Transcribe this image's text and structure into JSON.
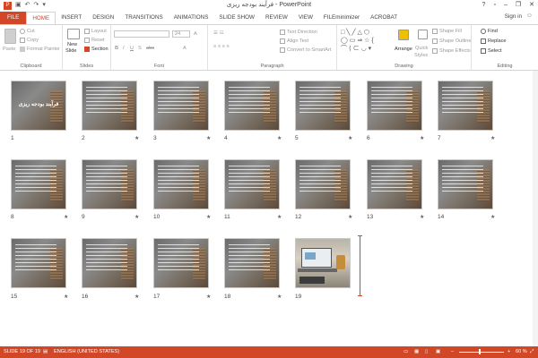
{
  "window": {
    "title": "فرآیند بودجه ریزی - PowerPoint",
    "minimize": "–",
    "restore": "❐",
    "close": "✕",
    "help": "?",
    "ribbon_display": "▫"
  },
  "tabs": [
    "FILE",
    "HOME",
    "INSERT",
    "DESIGN",
    "TRANSITIONS",
    "ANIMATIONS",
    "SLIDE SHOW",
    "REVIEW",
    "VIEW",
    "FILEminimizer",
    "ACROBAT"
  ],
  "active_tab": "HOME",
  "sign_in": "Sign in",
  "ribbon": {
    "clipboard": {
      "label": "Clipboard",
      "paste": "Paste",
      "cut": "Cut",
      "copy": "Copy",
      "format_painter": "Format Painter"
    },
    "slides": {
      "label": "Slides",
      "new_slide": "New",
      "new_slide2": "Slide",
      "layout": "Layout",
      "reset": "Reset",
      "section": "Section"
    },
    "font": {
      "label": "Font",
      "size": "24"
    },
    "paragraph": {
      "label": "Paragraph",
      "text_direction": "Text Direction",
      "align_text": "Align Text",
      "convert_smartart": "Convert to SmartArt"
    },
    "drawing": {
      "label": "Drawing",
      "arrange": "Arrange",
      "quick_styles": "Quick",
      "quick_styles2": "Styles",
      "shape_fill": "Shape Fill",
      "shape_outline": "Shape Outline",
      "shape_effects": "Shape Effects"
    },
    "editing": {
      "label": "Editing",
      "find": "Find",
      "replace": "Replace",
      "select": "Select"
    }
  },
  "slides": [
    {
      "num": "1",
      "title": "فرآیند بودجه ریزی",
      "star": ""
    },
    {
      "num": "2",
      "star": "★"
    },
    {
      "num": "3",
      "star": "★"
    },
    {
      "num": "4",
      "star": "★"
    },
    {
      "num": "5",
      "star": "★"
    },
    {
      "num": "6",
      "star": "★"
    },
    {
      "num": "7",
      "star": "★"
    },
    {
      "num": "8",
      "star": "★"
    },
    {
      "num": "9",
      "star": "★"
    },
    {
      "num": "10",
      "star": "★"
    },
    {
      "num": "11",
      "star": "★"
    },
    {
      "num": "12",
      "star": "★"
    },
    {
      "num": "13",
      "star": "★"
    },
    {
      "num": "14",
      "star": "★"
    },
    {
      "num": "15",
      "star": "★"
    },
    {
      "num": "16",
      "star": "★"
    },
    {
      "num": "17",
      "star": "★"
    },
    {
      "num": "18",
      "star": "★"
    },
    {
      "num": "19",
      "star": ""
    }
  ],
  "status": {
    "slide_info": "SLIDE 19 OF 19",
    "language": "ENGLISH (UNITED STATES)",
    "zoom": "60 %",
    "zoom_minus": "–",
    "zoom_plus": "+"
  },
  "colors": {
    "accent": "#d24726"
  }
}
